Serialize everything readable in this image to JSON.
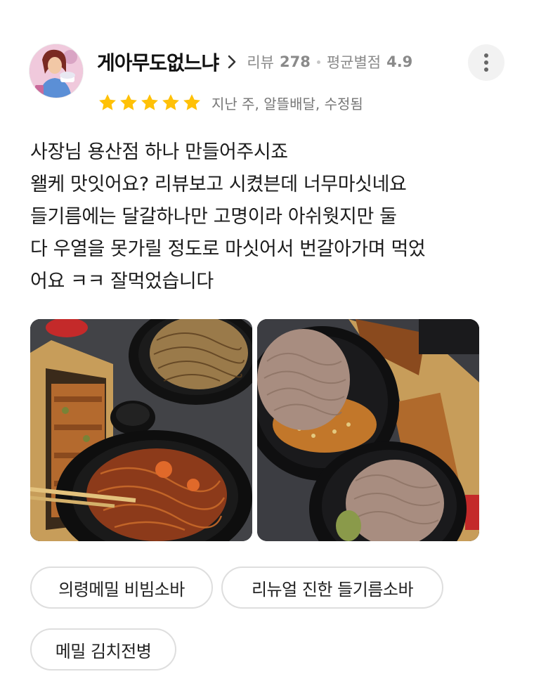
{
  "author": {
    "name": "게아무도없느냐",
    "review_label": "리뷰",
    "review_count": "278",
    "avg_label": "평균별점",
    "avg_rating": "4.9"
  },
  "rating": {
    "stars": 5,
    "max": 5,
    "star_color": "#FFC107",
    "meta": "지난 주, 알뜰배달, 수정됨"
  },
  "review": {
    "lines": [
      "사장님 용산점 하나 만들어주시죠",
      "왤케 맛잇어요? 리뷰보고 시켰븐데 너무마싯네요",
      "들기름에는 달갈하나만 고명이라 아쉬웟지만 둘",
      "다 우열을 못가릴 정도로 마싯어서 번갈아가며 먹었",
      "어요 ㅋㅋ 잘먹었습니다"
    ]
  },
  "menu_tags": [
    "의령메밀 비빔소바",
    "리뉴얼 진한 들기름소바",
    "메밀 김치전병"
  ],
  "icons": {
    "more": "more-vertical-icon",
    "chevron": "chevron-right-icon",
    "star": "star-icon"
  }
}
